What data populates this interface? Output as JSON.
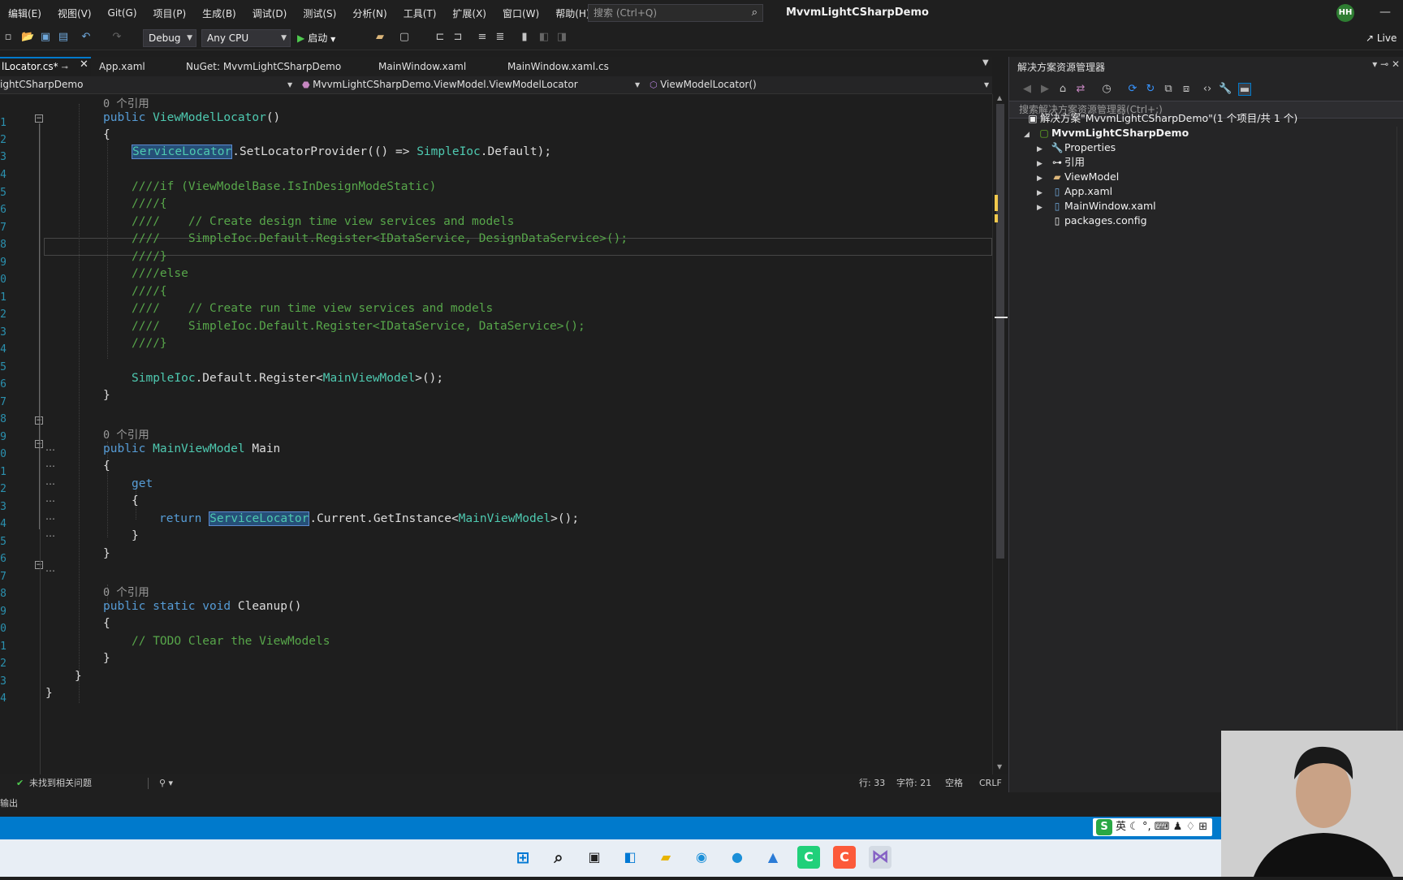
{
  "menu": [
    "编辑(E)",
    "视图(V)",
    "Git(G)",
    "项目(P)",
    "生成(B)",
    "调试(D)",
    "测试(S)",
    "分析(N)",
    "工具(T)",
    "扩展(X)",
    "窗口(W)",
    "帮助(H)"
  ],
  "search": {
    "placeholder": "搜索 (Ctrl+Q)"
  },
  "app_title": "MvvmLightCSharpDemo",
  "avatar_initials": "HH",
  "toolbar": {
    "config": "Debug",
    "platform": "Any CPU",
    "start_label": "启动",
    "live_share": "Live"
  },
  "tabs": [
    {
      "label": "lLocator.cs*",
      "active": true
    },
    {
      "label": "App.xaml"
    },
    {
      "label": "NuGet: MvvmLightCSharpDemo"
    },
    {
      "label": "MainWindow.xaml"
    },
    {
      "label": "MainWindow.xaml.cs"
    }
  ],
  "navbar": {
    "project": "ightCSharpDemo",
    "class": "MvvmLightCSharpDemo.ViewModel.ViewModelLocator",
    "member": "ViewModelLocator()"
  },
  "code": {
    "line_numbers": [
      "1",
      "2",
      "3",
      "4",
      "5",
      "6",
      "7",
      "8",
      "9",
      "0",
      "1",
      "2",
      "3",
      "4",
      "5",
      "6",
      "7",
      "8",
      "9",
      "0",
      "1",
      "2",
      "3",
      "4",
      "5",
      "6",
      "7",
      "8",
      "9",
      "0",
      "1",
      "2",
      "3",
      "4"
    ],
    "lens1": "0 个引用",
    "lens2": "0 个引用",
    "lens3": "0 个引用",
    "l_ctor_kw": "public",
    "l_ctor_name": "ViewModelLocator",
    "l_ctor_rest": "()",
    "brace_open": "{",
    "brace_close": "}",
    "sl_service": "ServiceLocator",
    "sl_rest1": ".SetLocatorProvider(() => ",
    "sl_simple": "SimpleIoc",
    "sl_rest2": ".Default);",
    "c1": "////if (ViewModelBase.IsInDesignModeStatic)",
    "c2": "////{",
    "c3": "////    // Create design time view services and models",
    "c4": "////    SimpleIoc.Default.Register<IDataService, DesignDataService>();",
    "c5": "////}",
    "c6": "////else",
    "c7": "////{",
    "c8": "////    // Create run time view services and models",
    "c9": "////    SimpleIoc.Default.Register<IDataService, DataService>();",
    "c10": "////}",
    "reg_simple": "SimpleIoc",
    "reg_rest1": ".Default.Register<",
    "reg_type": "MainViewModel",
    "reg_rest2": ">();",
    "main_kw": "public",
    "main_type": "MainViewModel",
    "main_name": " Main",
    "get_kw": "get",
    "ret_kw": "return",
    "ret_service": "ServiceLocator",
    "ret_rest1": ".Current.GetInstance<",
    "ret_type": "MainViewModel",
    "ret_rest2": ">();",
    "cleanup_kw": "public static void",
    "cleanup_name": " Cleanup()",
    "todo": "// TODO Clear the ViewModels"
  },
  "editor_status": {
    "issues": "未找到相关问题",
    "line": "行: 33",
    "char": "字符: 21",
    "spaces": "空格",
    "eol": "CRLF"
  },
  "output_label": "输出",
  "solution_explorer": {
    "title": "解决方案资源管理器",
    "search_placeholder": "搜索解决方案资源管理器(Ctrl+;)",
    "solution": "解决方案\"MvvmLightCSharpDemo\"(1 个项目/共 1 个)",
    "project": "MvvmLightCSharpDemo",
    "items": [
      "Properties",
      "引用",
      "ViewModel",
      "App.xaml",
      "MainWindow.xaml",
      "packages.config"
    ]
  },
  "ime": {
    "lang": "英"
  },
  "colors": {
    "accent": "#007acc",
    "keyword": "#569cd6",
    "type": "#4ec9b0",
    "comment": "#57a64a"
  }
}
